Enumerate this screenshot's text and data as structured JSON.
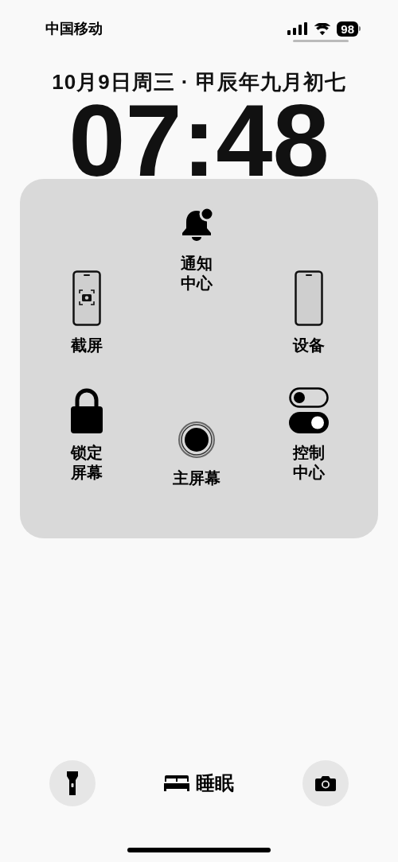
{
  "status_bar": {
    "carrier": "中国移动",
    "battery": "98"
  },
  "date": "10月9日周三 · 甲辰年九月初七",
  "time": "07:48",
  "menu": {
    "left": [
      {
        "kind": "screenshot",
        "label": "截屏"
      },
      {
        "kind": "lock",
        "label": "锁定屏幕"
      }
    ],
    "center": [
      {
        "kind": "notification",
        "label": "通知中心"
      },
      {
        "kind": "home",
        "label": "主屏幕"
      }
    ],
    "right": [
      {
        "kind": "device",
        "label": "设备"
      },
      {
        "kind": "control",
        "label": "控制中心"
      }
    ]
  },
  "bottom": {
    "left": {
      "kind": "flashlight"
    },
    "focus": {
      "kind": "sleep",
      "label": "睡眠"
    },
    "right": {
      "kind": "camera"
    }
  }
}
